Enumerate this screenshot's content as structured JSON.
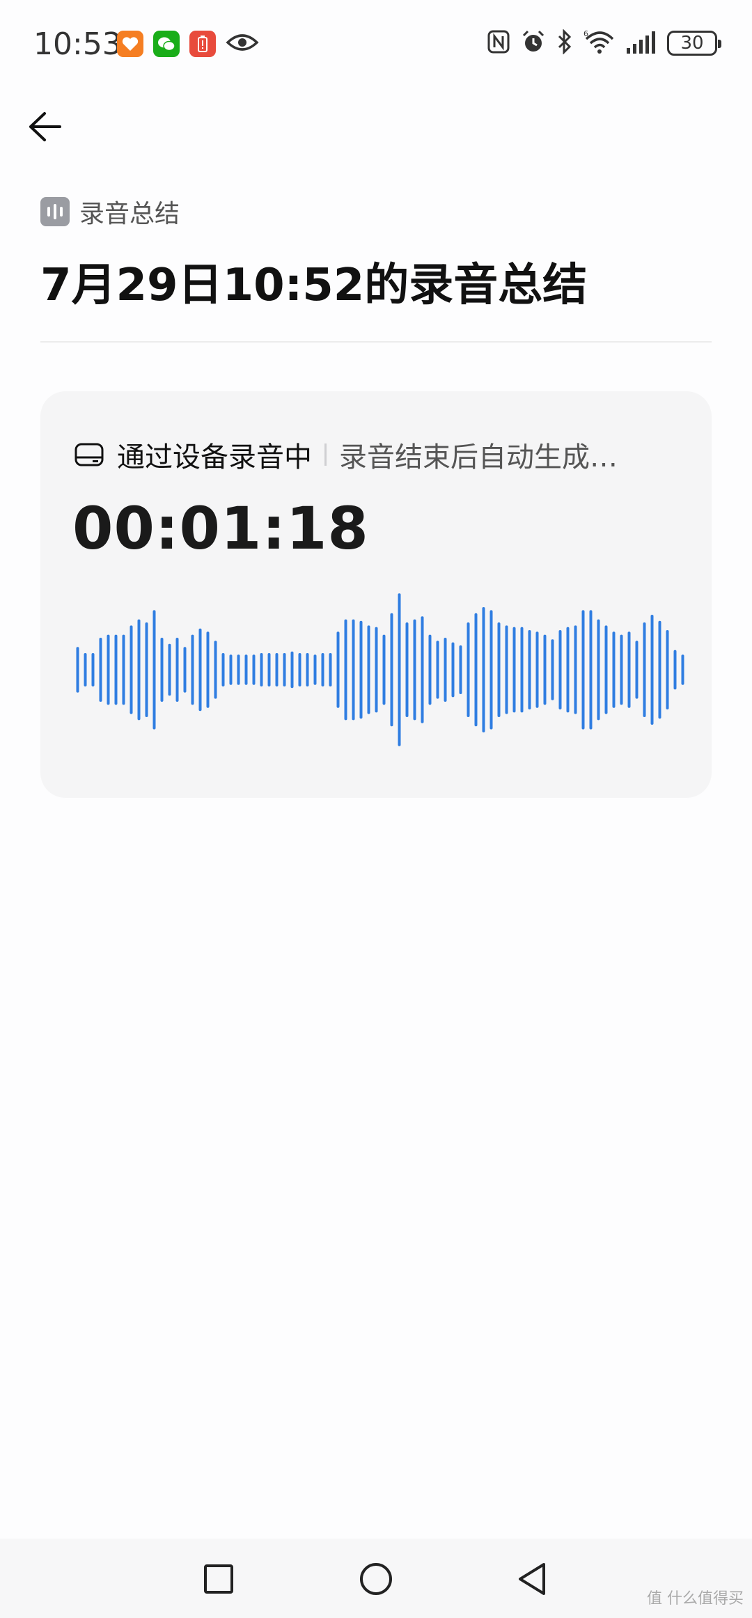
{
  "status_bar": {
    "time": "10:53",
    "notification_icons": [
      "taobao-icon",
      "wechat-icon",
      "battery-alert-icon",
      "eye-icon"
    ],
    "system_icons": [
      "nfc-icon",
      "alarm-icon",
      "bluetooth-icon",
      "wifi-6-icon",
      "signal-icon"
    ],
    "battery_level": "30"
  },
  "header": {
    "back_icon": "arrow-left-icon",
    "category_icon": "audio-wave-icon",
    "category_label": "录音总结",
    "title": "7月29日10:52的录音总结"
  },
  "recording_card": {
    "status_label": "通过设备录音中",
    "status_sub": "录音结束后自动生成…",
    "timer": "00:01:18",
    "waveform_color": "#2f7de1",
    "waveform_levels": [
      0.28,
      0.2,
      0.2,
      0.4,
      0.44,
      0.44,
      0.44,
      0.56,
      0.64,
      0.6,
      0.76,
      0.4,
      0.32,
      0.4,
      0.28,
      0.44,
      0.52,
      0.48,
      0.36,
      0.2,
      0.18,
      0.18,
      0.18,
      0.18,
      0.2,
      0.2,
      0.2,
      0.2,
      0.22,
      0.2,
      0.2,
      0.18,
      0.2,
      0.2,
      0.48,
      0.64,
      0.64,
      0.62,
      0.56,
      0.54,
      0.44,
      0.72,
      0.98,
      0.6,
      0.64,
      0.68,
      0.44,
      0.36,
      0.4,
      0.34,
      0.3,
      0.6,
      0.72,
      0.8,
      0.76,
      0.6,
      0.56,
      0.54,
      0.54,
      0.5,
      0.48,
      0.44,
      0.38,
      0.5,
      0.54,
      0.56,
      0.76,
      0.76,
      0.64,
      0.56,
      0.48,
      0.44,
      0.48,
      0.36,
      0.6,
      0.7,
      0.62,
      0.5,
      0.24,
      0.18
    ]
  },
  "nav_bar": {
    "buttons": [
      "recents-square-icon",
      "home-circle-icon",
      "back-triangle-icon"
    ],
    "watermark": "值 什么值得买"
  }
}
